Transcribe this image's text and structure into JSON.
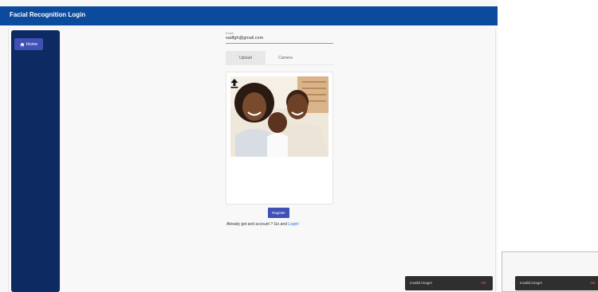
{
  "app": {
    "title": "Facial Recognition Login"
  },
  "sidebar": {
    "home_label": "Home"
  },
  "form": {
    "email_label": "Email",
    "email_value": "sadfgh@gmail.com",
    "tabs": [
      {
        "label": "Upload",
        "active": true
      },
      {
        "label": "Camera",
        "active": false
      }
    ],
    "register_label": "Register",
    "login_prompt": "Already got and account ? Go and",
    "login_link": "Login!"
  },
  "toast": {
    "message": "Invalid Image!",
    "action": "OK"
  },
  "zoom_toast": {
    "message": "Invalid Image!",
    "action": "OK"
  },
  "colors": {
    "topbar": "#0b4a9c",
    "sidebar": "#0d2a63",
    "primary": "#3f51b5",
    "toast_bg": "#2f2f2f",
    "toast_action": "#ff5b6e"
  }
}
